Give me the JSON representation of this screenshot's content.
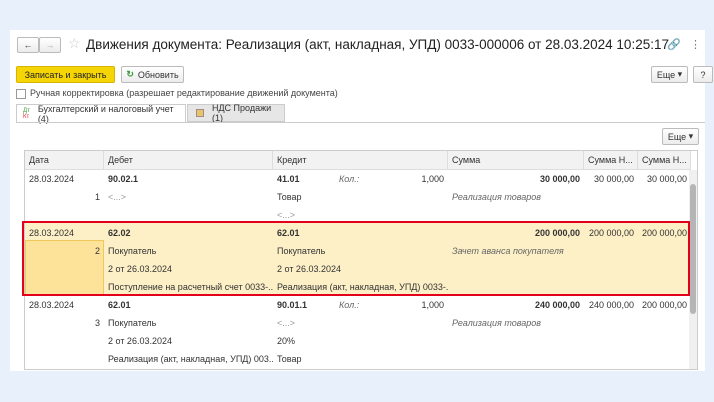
{
  "window": {
    "title": "Движения документа: Реализация (акт, накладная, УПД) 0033-000006 от 28.03.2024 10:25:17"
  },
  "toolbar": {
    "save_close": "Записать и закрыть",
    "refresh": "Обновить",
    "more": "Еще",
    "help": "?"
  },
  "manual": {
    "label": "Ручная корректировка (разрешает редактирование движений документа)",
    "checked": false
  },
  "tabs": [
    {
      "label": "Бухгалтерский и налоговый учет (4)",
      "active": true
    },
    {
      "label": "НДС Продажи (1)",
      "active": false
    }
  ],
  "grid": {
    "more": "Еще",
    "columns": [
      "Дата",
      "Дебет",
      "Кредит",
      "Сумма",
      "Сумма Н...",
      "Сумма Н..."
    ],
    "rows": [
      {
        "date": "28.03.2024",
        "num": "1",
        "debit": [
          "90.02.1",
          "<...>",
          "",
          ""
        ],
        "credit": [
          "41.01",
          "Товар",
          "<...>",
          ""
        ],
        "qty_label": "Кол.:",
        "qty": "1,000",
        "sum": "30 000,00",
        "sum_n1": "30 000,00",
        "sum_n2": "30 000,00",
        "content": "Реализация товаров"
      },
      {
        "date": "28.03.2024",
        "num": "2",
        "debit": [
          "62.02",
          "Покупатель",
          "2 от 26.03.2024",
          "Поступление на расчетный счет 0033-..."
        ],
        "credit": [
          "62.01",
          "Покупатель",
          "2 от 26.03.2024",
          "Реализация (акт, накладная, УПД) 0033-..."
        ],
        "sum": "200 000,00",
        "sum_n1": "200 000,00",
        "sum_n2": "200 000,00",
        "content": "Зачет аванса покупателя"
      },
      {
        "date": "28.03.2024",
        "num": "3",
        "debit": [
          "62.01",
          "Покупатель",
          "2 от 26.03.2024",
          "Реализация (акт, накладная, УПД) 003..."
        ],
        "credit": [
          "90.01.1",
          "<...>",
          "20%",
          "Товар"
        ],
        "qty_label": "Кол.:",
        "qty": "1,000",
        "sum": "240 000,00",
        "sum_n1": "240 000,00",
        "sum_n2": "200 000,00",
        "content": "Реализация товаров"
      }
    ]
  },
  "colors": {
    "accent": "#f5d506",
    "highlight": "#fdf0c6",
    "selection": "#e3001b"
  }
}
